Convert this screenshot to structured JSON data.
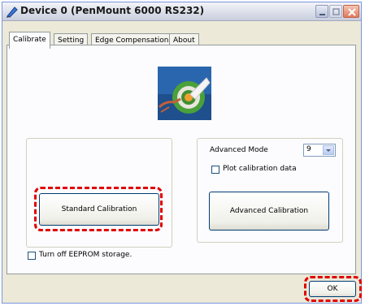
{
  "window": {
    "title": "Device 0 (PenMount 6000 RS232)",
    "icons": {
      "app": "pen-icon",
      "minimize": "minimize-icon",
      "maximize": "maximize-icon",
      "close": "close-icon"
    }
  },
  "tabs": [
    {
      "label": "Calibrate",
      "active": true
    },
    {
      "label": "Setting",
      "active": false
    },
    {
      "label": "Edge Compensation",
      "active": false
    },
    {
      "label": "About",
      "active": false
    }
  ],
  "logo": {
    "icon": "target-calibration-icon"
  },
  "standard": {
    "button_label": "Standard Calibration"
  },
  "advanced": {
    "mode_label": "Advanced Mode",
    "mode_value": "9",
    "plot_label": "Plot calibration data",
    "plot_checked": false,
    "button_label": "Advanced Calibration"
  },
  "eeprom": {
    "label": "Turn off EEPROM storage.",
    "checked": false
  },
  "footer": {
    "ok_label": "OK"
  },
  "colors": {
    "highlight": "#e00000",
    "titlebar": "#d9dde8",
    "dialog": "#ece9d8"
  }
}
